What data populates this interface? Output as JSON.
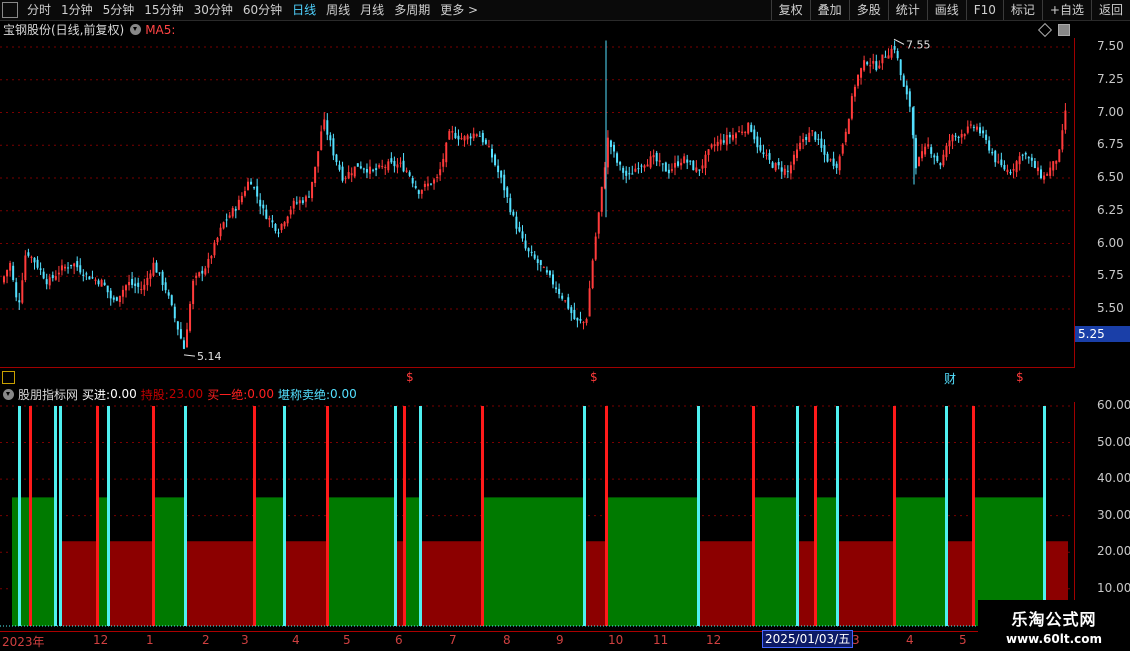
{
  "toolbar": {
    "periods": [
      "分时",
      "1分钟",
      "5分钟",
      "15分钟",
      "30分钟",
      "60分钟",
      "日线",
      "周线",
      "月线",
      "多周期",
      "更多 >"
    ],
    "active": "日线",
    "buttons": [
      "复权",
      "叠加",
      "多股",
      "统计",
      "画线",
      "F10",
      "标记",
      "+自选",
      "返回"
    ]
  },
  "main": {
    "title": "宝钢股份(日线,前复权)",
    "ma_label": "MA5:",
    "high_label": "7.55",
    "low_label": "5.14",
    "current_price": "5.25",
    "price_axis": [
      "7.50",
      "7.25",
      "7.00",
      "6.75",
      "6.50",
      "6.25",
      "6.00",
      "5.75",
      "5.50"
    ]
  },
  "event_marks": {
    "s1": "$",
    "s2": "$",
    "s3": "财",
    "s4": "$"
  },
  "indicator": {
    "name": "股朋指标网",
    "buy_label": "买进:",
    "buy_value": "0.00",
    "hold_label": "持股:",
    "hold_value": "23.00",
    "buy_all_label": "买一绝:",
    "buy_all_value": "0.00",
    "sell_label": "堪称卖绝:",
    "sell_value": "0.00",
    "axis": [
      "60.00",
      "50.00",
      "40.00",
      "30.00",
      "20.00",
      "10.00"
    ]
  },
  "date_axis": {
    "labels": [
      "2023年",
      "12",
      "1",
      "2",
      "3",
      "4",
      "5",
      "6",
      "7",
      "8",
      "9",
      "10",
      "11",
      "12",
      "1",
      "3",
      "4",
      "5"
    ],
    "highlight": "2025/01/03/五"
  },
  "watermark": {
    "line1": "乐淘公式网",
    "line2": "www.60lt.com"
  },
  "colors": {
    "up": "#ff3b3b",
    "down": "#54e0ff",
    "green_band": "#007a00",
    "red_band": "#8c0000",
    "grid": "#7a0000"
  },
  "chart_data": {
    "type": "candlestick+indicator",
    "price_range": [
      5.0,
      7.6
    ],
    "price_ticks": [
      5.5,
      5.75,
      6.0,
      6.25,
      6.5,
      6.75,
      7.0,
      7.25,
      7.5
    ],
    "high": 7.55,
    "low": 5.14,
    "last": 5.25,
    "indicator_range": [
      0,
      65
    ],
    "indicator_ticks": [
      10,
      20,
      30,
      40,
      50,
      60
    ],
    "hold_levels": {
      "green": 35,
      "red": 23
    }
  }
}
